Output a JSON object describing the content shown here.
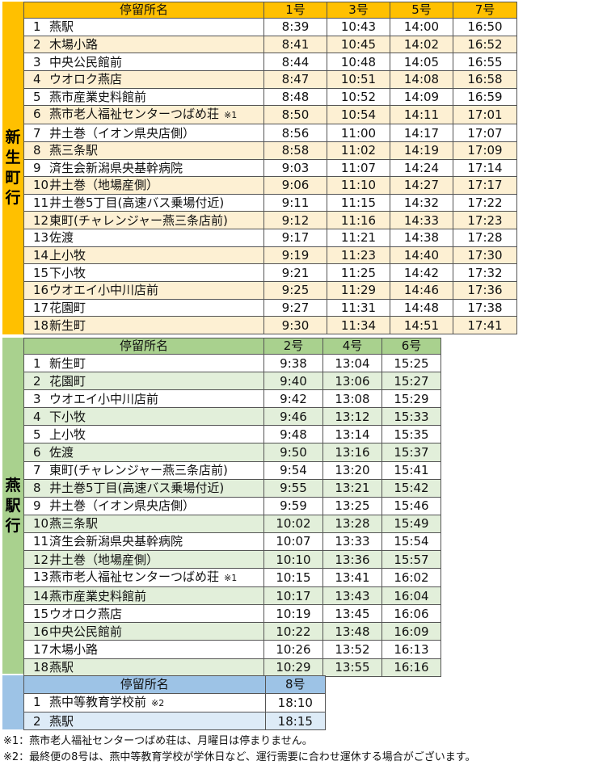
{
  "colors": {
    "orange": "#ffc000",
    "green": "#a9d18e",
    "blue": "#9dc3e6"
  },
  "section1": {
    "side_label": [
      "新",
      "生",
      "町",
      "行"
    ],
    "headers": [
      "停留所名",
      "1号",
      "3号",
      "5号",
      "7号"
    ],
    "rows": [
      {
        "no": "1",
        "stop": "燕駅",
        "suffix": "",
        "times": [
          "8:39",
          "10:43",
          "14:00",
          "16:50"
        ]
      },
      {
        "no": "2",
        "stop": "木場小路",
        "suffix": "",
        "times": [
          "8:41",
          "10:45",
          "14:02",
          "16:52"
        ]
      },
      {
        "no": "3",
        "stop": "中央公民館前",
        "suffix": "",
        "times": [
          "8:44",
          "10:48",
          "14:05",
          "16:55"
        ]
      },
      {
        "no": "4",
        "stop": "ウオロク燕店",
        "suffix": "",
        "times": [
          "8:47",
          "10:51",
          "14:08",
          "16:58"
        ]
      },
      {
        "no": "5",
        "stop": "燕市産業史料館前",
        "suffix": "",
        "times": [
          "8:48",
          "10:52",
          "14:09",
          "16:59"
        ]
      },
      {
        "no": "6",
        "stop": "燕市老人福祉センターつばめ荘",
        "suffix": "※1",
        "times": [
          "8:50",
          "10:54",
          "14:11",
          "17:01"
        ]
      },
      {
        "no": "7",
        "stop": "井土巻（イオン県央店側）",
        "suffix": "",
        "times": [
          "8:56",
          "11:00",
          "14:17",
          "17:07"
        ]
      },
      {
        "no": "8",
        "stop": "燕三条駅",
        "suffix": "",
        "times": [
          "8:58",
          "11:02",
          "14:19",
          "17:09"
        ]
      },
      {
        "no": "9",
        "stop": "済生会新潟県央基幹病院",
        "suffix": "",
        "times": [
          "9:03",
          "11:07",
          "14:24",
          "17:14"
        ]
      },
      {
        "no": "10",
        "stop": "井土巻（地場産側）",
        "suffix": "",
        "times": [
          "9:06",
          "11:10",
          "14:27",
          "17:17"
        ]
      },
      {
        "no": "11",
        "stop": "井土巻5丁目(高速バス乗場付近)",
        "suffix": "",
        "times": [
          "9:11",
          "11:15",
          "14:32",
          "17:22"
        ]
      },
      {
        "no": "12",
        "stop": "東町(チャレンジャー燕三条店前)",
        "suffix": "",
        "times": [
          "9:12",
          "11:16",
          "14:33",
          "17:23"
        ]
      },
      {
        "no": "13",
        "stop": "佐渡",
        "suffix": "",
        "times": [
          "9:17",
          "11:21",
          "14:38",
          "17:28"
        ]
      },
      {
        "no": "14",
        "stop": "上小牧",
        "suffix": "",
        "times": [
          "9:19",
          "11:23",
          "14:40",
          "17:30"
        ]
      },
      {
        "no": "15",
        "stop": "下小牧",
        "suffix": "",
        "times": [
          "9:21",
          "11:25",
          "14:42",
          "17:32"
        ]
      },
      {
        "no": "16",
        "stop": "ウオエイ小中川店前",
        "suffix": "",
        "times": [
          "9:25",
          "11:29",
          "14:46",
          "17:36"
        ]
      },
      {
        "no": "17",
        "stop": "花園町",
        "suffix": "",
        "times": [
          "9:27",
          "11:31",
          "14:48",
          "17:38"
        ]
      },
      {
        "no": "18",
        "stop": "新生町",
        "suffix": "",
        "times": [
          "9:30",
          "11:34",
          "14:51",
          "17:41"
        ]
      }
    ]
  },
  "section2": {
    "side_label": [
      "燕",
      "駅",
      "行"
    ],
    "headers": [
      "停留所名",
      "2号",
      "4号",
      "6号"
    ],
    "rows": [
      {
        "no": "1",
        "stop": "新生町",
        "suffix": "",
        "times": [
          "9:38",
          "13:04",
          "15:25"
        ]
      },
      {
        "no": "2",
        "stop": "花園町",
        "suffix": "",
        "times": [
          "9:40",
          "13:06",
          "15:27"
        ]
      },
      {
        "no": "3",
        "stop": "ウオエイ小中川店前",
        "suffix": "",
        "times": [
          "9:42",
          "13:08",
          "15:29"
        ]
      },
      {
        "no": "4",
        "stop": "下小牧",
        "suffix": "",
        "times": [
          "9:46",
          "13:12",
          "15:33"
        ]
      },
      {
        "no": "5",
        "stop": "上小牧",
        "suffix": "",
        "times": [
          "9:48",
          "13:14",
          "15:35"
        ]
      },
      {
        "no": "6",
        "stop": "佐渡",
        "suffix": "",
        "times": [
          "9:50",
          "13:16",
          "15:37"
        ]
      },
      {
        "no": "7",
        "stop": "東町(チャレンジャー燕三条店前)",
        "suffix": "",
        "times": [
          "9:54",
          "13:20",
          "15:41"
        ]
      },
      {
        "no": "8",
        "stop": "井土巻5丁目(高速バス乗場付近)",
        "suffix": "",
        "times": [
          "9:55",
          "13:21",
          "15:42"
        ]
      },
      {
        "no": "9",
        "stop": "井土巻（イオン県央店側）",
        "suffix": "",
        "times": [
          "9:59",
          "13:25",
          "15:46"
        ]
      },
      {
        "no": "10",
        "stop": "燕三条駅",
        "suffix": "",
        "times": [
          "10:02",
          "13:28",
          "15:49"
        ]
      },
      {
        "no": "11",
        "stop": "済生会新潟県央基幹病院",
        "suffix": "",
        "times": [
          "10:07",
          "13:33",
          "15:54"
        ]
      },
      {
        "no": "12",
        "stop": "井土巻（地場産側）",
        "suffix": "",
        "times": [
          "10:10",
          "13:36",
          "15:57"
        ]
      },
      {
        "no": "13",
        "stop": "燕市老人福祉センターつばめ荘",
        "suffix": "※1",
        "times": [
          "10:15",
          "13:41",
          "16:02"
        ]
      },
      {
        "no": "14",
        "stop": "燕市産業史料館前",
        "suffix": "",
        "times": [
          "10:17",
          "13:43",
          "16:04"
        ]
      },
      {
        "no": "15",
        "stop": "ウオロク燕店",
        "suffix": "",
        "times": [
          "10:19",
          "13:45",
          "16:06"
        ]
      },
      {
        "no": "16",
        "stop": "中央公民館前",
        "suffix": "",
        "times": [
          "10:22",
          "13:48",
          "16:09"
        ]
      },
      {
        "no": "17",
        "stop": "木場小路",
        "suffix": "",
        "times": [
          "10:26",
          "13:52",
          "16:13"
        ]
      },
      {
        "no": "18",
        "stop": "燕駅",
        "suffix": "",
        "times": [
          "10:29",
          "13:55",
          "16:16"
        ]
      }
    ]
  },
  "section3": {
    "headers": [
      "停留所名",
      "8号"
    ],
    "rows": [
      {
        "no": "1",
        "stop": "燕中等教育学校前",
        "suffix": "※2",
        "times": [
          "18:10"
        ]
      },
      {
        "no": "2",
        "stop": "燕駅",
        "suffix": "",
        "times": [
          "18:15"
        ]
      }
    ]
  },
  "notes": {
    "note1": "※1：燕市老人福祉センターつばめ荘は、月曜日は停まりません。",
    "note2": "※2：最終便の8号は、燕中等教育学校が学休日など、運行需要に合わせ運休する場合がございます。"
  }
}
